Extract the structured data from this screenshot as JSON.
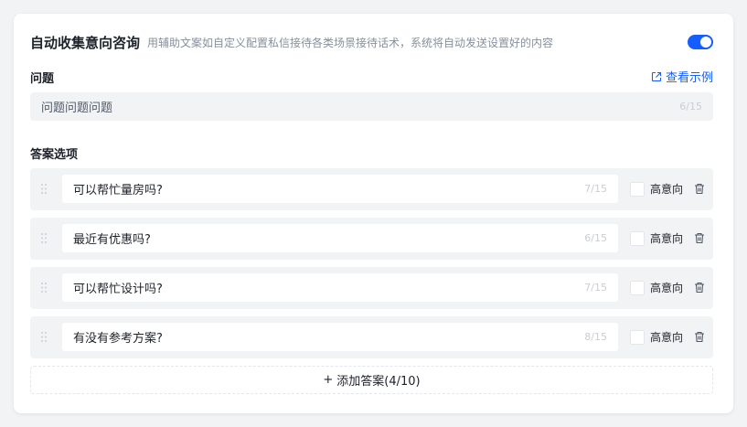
{
  "header": {
    "title": "自动收集意向咨询",
    "description": "用辅助文案如自定义配置私信接待各类场景接待话术，系统将自动发送设置好的内容",
    "toggle_on": true,
    "accent_color": "#165dff"
  },
  "question": {
    "label": "问题",
    "example_link": "查看示例",
    "value": "问题问题问题",
    "counter": "6/15"
  },
  "answers": {
    "label": "答案选项",
    "checkbox_label": "高意向",
    "items": [
      {
        "text": "可以帮忙量房吗?",
        "counter": "7/15",
        "checked": false
      },
      {
        "text": "最近有优惠吗?",
        "counter": "6/15",
        "checked": false
      },
      {
        "text": "可以帮忙设计吗?",
        "counter": "7/15",
        "checked": false
      },
      {
        "text": "有没有参考方案?",
        "counter": "8/15",
        "checked": false
      }
    ],
    "add_button": "添加答案(4/10)",
    "add_icon": "+"
  }
}
